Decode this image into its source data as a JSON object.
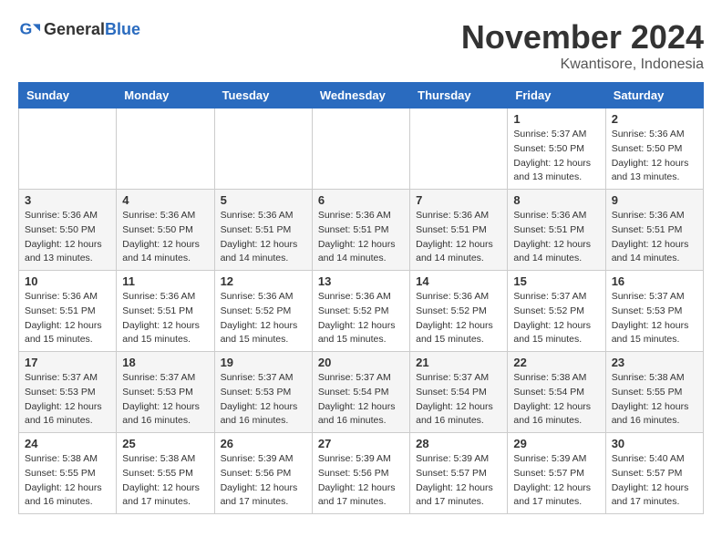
{
  "header": {
    "logo_general": "General",
    "logo_blue": "Blue",
    "month": "November 2024",
    "location": "Kwantisore, Indonesia"
  },
  "weekdays": [
    "Sunday",
    "Monday",
    "Tuesday",
    "Wednesday",
    "Thursday",
    "Friday",
    "Saturday"
  ],
  "weeks": [
    [
      {
        "day": "",
        "info": ""
      },
      {
        "day": "",
        "info": ""
      },
      {
        "day": "",
        "info": ""
      },
      {
        "day": "",
        "info": ""
      },
      {
        "day": "",
        "info": ""
      },
      {
        "day": "1",
        "info": "Sunrise: 5:37 AM\nSunset: 5:50 PM\nDaylight: 12 hours\nand 13 minutes."
      },
      {
        "day": "2",
        "info": "Sunrise: 5:36 AM\nSunset: 5:50 PM\nDaylight: 12 hours\nand 13 minutes."
      }
    ],
    [
      {
        "day": "3",
        "info": "Sunrise: 5:36 AM\nSunset: 5:50 PM\nDaylight: 12 hours\nand 13 minutes."
      },
      {
        "day": "4",
        "info": "Sunrise: 5:36 AM\nSunset: 5:50 PM\nDaylight: 12 hours\nand 14 minutes."
      },
      {
        "day": "5",
        "info": "Sunrise: 5:36 AM\nSunset: 5:51 PM\nDaylight: 12 hours\nand 14 minutes."
      },
      {
        "day": "6",
        "info": "Sunrise: 5:36 AM\nSunset: 5:51 PM\nDaylight: 12 hours\nand 14 minutes."
      },
      {
        "day": "7",
        "info": "Sunrise: 5:36 AM\nSunset: 5:51 PM\nDaylight: 12 hours\nand 14 minutes."
      },
      {
        "day": "8",
        "info": "Sunrise: 5:36 AM\nSunset: 5:51 PM\nDaylight: 12 hours\nand 14 minutes."
      },
      {
        "day": "9",
        "info": "Sunrise: 5:36 AM\nSunset: 5:51 PM\nDaylight: 12 hours\nand 14 minutes."
      }
    ],
    [
      {
        "day": "10",
        "info": "Sunrise: 5:36 AM\nSunset: 5:51 PM\nDaylight: 12 hours\nand 15 minutes."
      },
      {
        "day": "11",
        "info": "Sunrise: 5:36 AM\nSunset: 5:51 PM\nDaylight: 12 hours\nand 15 minutes."
      },
      {
        "day": "12",
        "info": "Sunrise: 5:36 AM\nSunset: 5:52 PM\nDaylight: 12 hours\nand 15 minutes."
      },
      {
        "day": "13",
        "info": "Sunrise: 5:36 AM\nSunset: 5:52 PM\nDaylight: 12 hours\nand 15 minutes."
      },
      {
        "day": "14",
        "info": "Sunrise: 5:36 AM\nSunset: 5:52 PM\nDaylight: 12 hours\nand 15 minutes."
      },
      {
        "day": "15",
        "info": "Sunrise: 5:37 AM\nSunset: 5:52 PM\nDaylight: 12 hours\nand 15 minutes."
      },
      {
        "day": "16",
        "info": "Sunrise: 5:37 AM\nSunset: 5:53 PM\nDaylight: 12 hours\nand 15 minutes."
      }
    ],
    [
      {
        "day": "17",
        "info": "Sunrise: 5:37 AM\nSunset: 5:53 PM\nDaylight: 12 hours\nand 16 minutes."
      },
      {
        "day": "18",
        "info": "Sunrise: 5:37 AM\nSunset: 5:53 PM\nDaylight: 12 hours\nand 16 minutes."
      },
      {
        "day": "19",
        "info": "Sunrise: 5:37 AM\nSunset: 5:53 PM\nDaylight: 12 hours\nand 16 minutes."
      },
      {
        "day": "20",
        "info": "Sunrise: 5:37 AM\nSunset: 5:54 PM\nDaylight: 12 hours\nand 16 minutes."
      },
      {
        "day": "21",
        "info": "Sunrise: 5:37 AM\nSunset: 5:54 PM\nDaylight: 12 hours\nand 16 minutes."
      },
      {
        "day": "22",
        "info": "Sunrise: 5:38 AM\nSunset: 5:54 PM\nDaylight: 12 hours\nand 16 minutes."
      },
      {
        "day": "23",
        "info": "Sunrise: 5:38 AM\nSunset: 5:55 PM\nDaylight: 12 hours\nand 16 minutes."
      }
    ],
    [
      {
        "day": "24",
        "info": "Sunrise: 5:38 AM\nSunset: 5:55 PM\nDaylight: 12 hours\nand 16 minutes."
      },
      {
        "day": "25",
        "info": "Sunrise: 5:38 AM\nSunset: 5:55 PM\nDaylight: 12 hours\nand 17 minutes."
      },
      {
        "day": "26",
        "info": "Sunrise: 5:39 AM\nSunset: 5:56 PM\nDaylight: 12 hours\nand 17 minutes."
      },
      {
        "day": "27",
        "info": "Sunrise: 5:39 AM\nSunset: 5:56 PM\nDaylight: 12 hours\nand 17 minutes."
      },
      {
        "day": "28",
        "info": "Sunrise: 5:39 AM\nSunset: 5:57 PM\nDaylight: 12 hours\nand 17 minutes."
      },
      {
        "day": "29",
        "info": "Sunrise: 5:39 AM\nSunset: 5:57 PM\nDaylight: 12 hours\nand 17 minutes."
      },
      {
        "day": "30",
        "info": "Sunrise: 5:40 AM\nSunset: 5:57 PM\nDaylight: 12 hours\nand 17 minutes."
      }
    ]
  ]
}
